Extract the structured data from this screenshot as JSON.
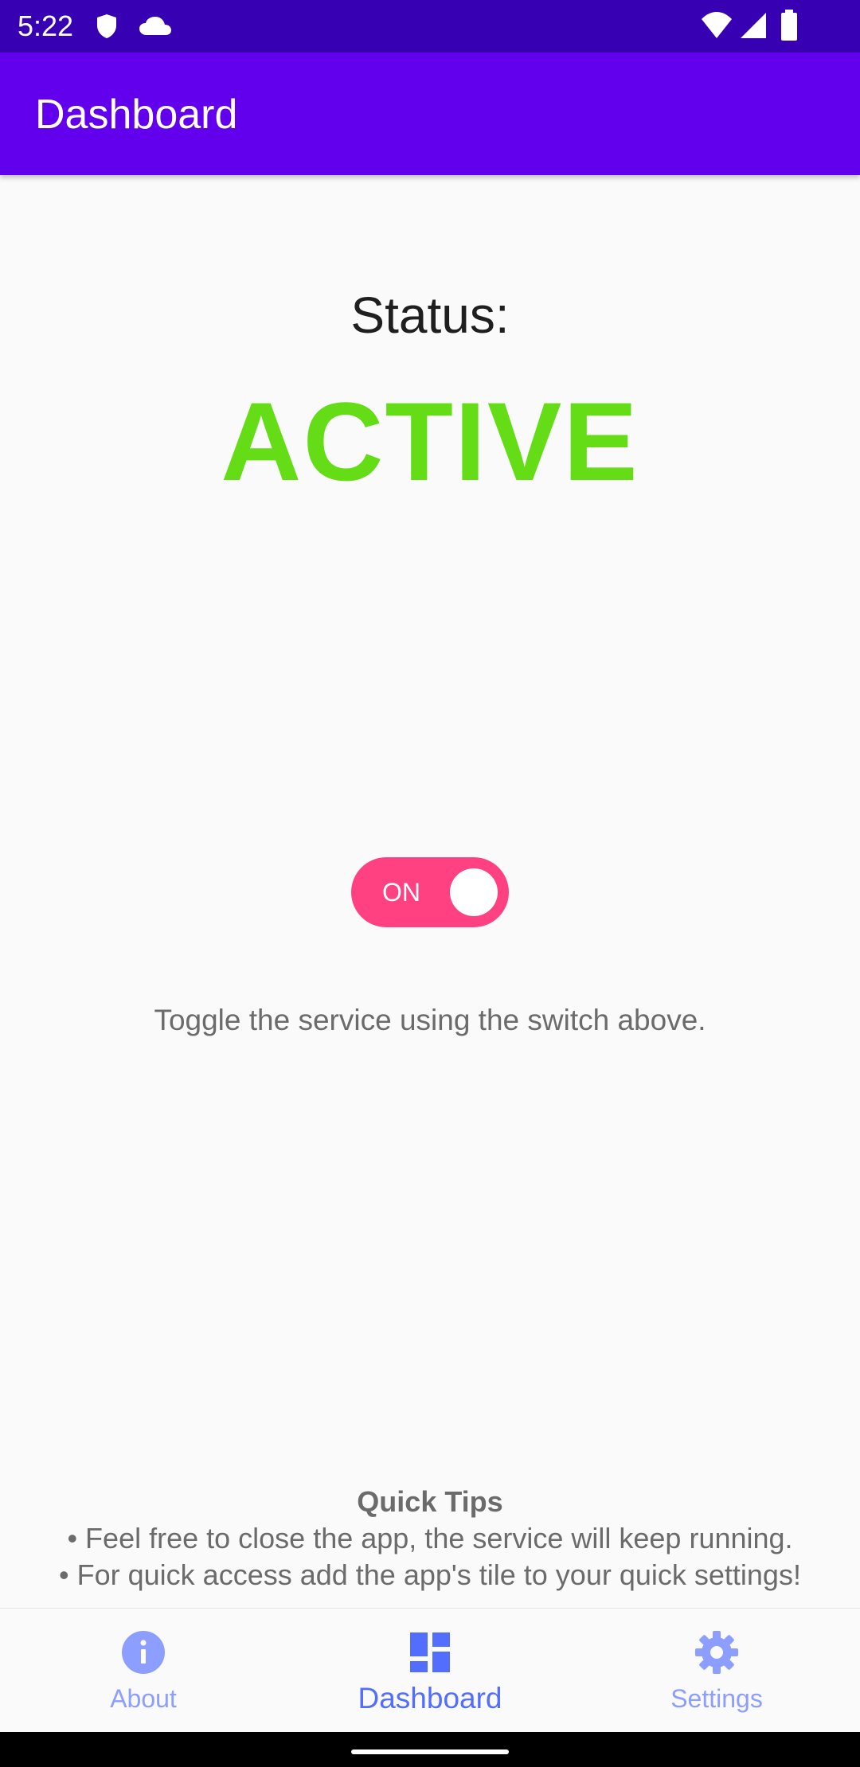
{
  "status_bar": {
    "time": "5:22",
    "icons": [
      "shield-icon",
      "cloud-icon",
      "wifi-icon",
      "signal-icon",
      "battery-icon"
    ]
  },
  "app_bar": {
    "title": "Dashboard"
  },
  "main": {
    "status_label": "Status:",
    "status_value": "ACTIVE",
    "toggle_label": "ON",
    "toggle_on": true,
    "hint": "Toggle the service using the switch above.",
    "tips": {
      "title": "Quick Tips",
      "lines": [
        "• Feel free to close the app, the service will keep running.",
        "• For quick access add the app's tile to your quick settings!"
      ]
    }
  },
  "bottom_nav": {
    "items": [
      {
        "label": "About",
        "icon": "info-icon",
        "active": false
      },
      {
        "label": "Dashboard",
        "icon": "dashboard-icon",
        "active": true
      },
      {
        "label": "Settings",
        "icon": "gear-icon",
        "active": false
      }
    ]
  },
  "colors": {
    "status_bar": "#3700b3",
    "app_bar": "#6200ee",
    "active_status": "#64dd17",
    "toggle": "#ff4081",
    "nav_active": "#536dfe",
    "nav_inactive": "#8c9eff",
    "body_text": "#6b6b6b"
  }
}
